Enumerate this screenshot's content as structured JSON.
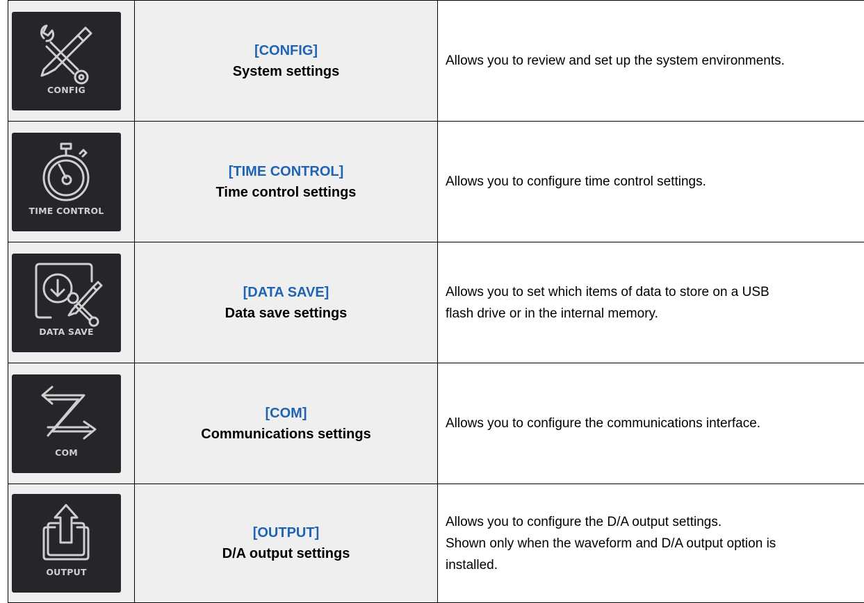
{
  "rows": [
    {
      "icon": "config-icon",
      "icon_label": "CONFIG",
      "code": "[CONFIG]",
      "title": "System settings",
      "description": [
        "Allows you to review and set up the system environments."
      ]
    },
    {
      "icon": "stopwatch-icon",
      "icon_label": "TIME CONTROL",
      "code": "[TIME CONTROL]",
      "title": "Time control settings",
      "description": [
        "Allows you to configure time control settings."
      ]
    },
    {
      "icon": "data-save-icon",
      "icon_label": "DATA SAVE",
      "code": "[DATA SAVE]",
      "title": "Data save settings",
      "description": [
        "Allows you to set which items of data to store on a USB",
        "flash drive or in the internal memory."
      ]
    },
    {
      "icon": "com-arrows-icon",
      "icon_label": "COM",
      "code": "[COM]",
      "title": "Communications settings",
      "description": [
        "Allows you to configure the communications interface."
      ]
    },
    {
      "icon": "output-icon",
      "icon_label": "OUTPUT",
      "code": "[OUTPUT]",
      "title": "D/A output settings",
      "description": [
        "Allows you to configure the D/A output settings.",
        "Shown only when the waveform and D/A output option is",
        "installed."
      ]
    }
  ],
  "colors": {
    "code_text": "#1f63b5",
    "cell_shade": "#efefef",
    "icon_background": "#26262a",
    "icon_stroke": "#cfcfcf"
  }
}
